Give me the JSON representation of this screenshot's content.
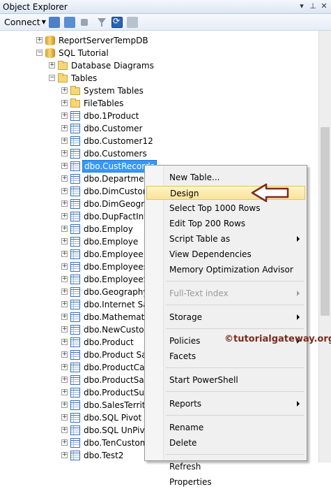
{
  "window": {
    "title": "Object Explorer",
    "pin_icon": "pin-icon",
    "close_icon": "close-icon"
  },
  "toolbar": {
    "connect_label": "Connect",
    "icons": [
      "connect-object-explorer-icon",
      "disconnect-icon",
      "stop-icon",
      "filter-icon",
      "refresh-icon",
      "activity-monitor-icon"
    ]
  },
  "tree": {
    "rows": [
      {
        "label": "ReportServerTempDB",
        "icon": "database-icon",
        "expander": "+"
      },
      {
        "label": "SQL Tutorial",
        "icon": "database-icon",
        "expander": "-"
      },
      {
        "label": "Database Diagrams",
        "icon": "folder-icon",
        "expander": "+"
      },
      {
        "label": "Tables",
        "icon": "folder-icon",
        "expander": "-"
      },
      {
        "label": "System Tables",
        "icon": "folder-icon",
        "expander": "+"
      },
      {
        "label": "FileTables",
        "icon": "folder-icon",
        "expander": "+"
      },
      {
        "label": "dbo.1Product",
        "icon": "table-icon",
        "expander": "+"
      },
      {
        "label": "dbo.Customer",
        "icon": "table-icon",
        "expander": "+"
      },
      {
        "label": "dbo.Customer12",
        "icon": "table-icon",
        "expander": "+"
      },
      {
        "label": "dbo.Customers",
        "icon": "table-icon",
        "expander": "+"
      },
      {
        "label": "dbo.CustRecords",
        "icon": "table-icon",
        "expander": "+",
        "selected": true
      },
      {
        "label": "dbo.Department",
        "icon": "table-icon",
        "expander": "+"
      },
      {
        "label": "dbo.DimCustom",
        "icon": "table-icon",
        "expander": "+"
      },
      {
        "label": "dbo.DimGeogra",
        "icon": "table-icon",
        "expander": "+"
      },
      {
        "label": "dbo.DupFactInte",
        "icon": "table-icon",
        "expander": "+"
      },
      {
        "label": "dbo.Employ",
        "icon": "table-icon",
        "expander": "+"
      },
      {
        "label": "dbo.Employe",
        "icon": "table-icon",
        "expander": "+"
      },
      {
        "label": "dbo.Employee",
        "icon": "table-icon",
        "expander": "+"
      },
      {
        "label": "dbo.Employees",
        "icon": "table-icon",
        "expander": "+"
      },
      {
        "label": "dbo.EmployeeSD",
        "icon": "table-icon",
        "expander": "+"
      },
      {
        "label": "dbo.Geography",
        "icon": "table-icon",
        "expander": "+"
      },
      {
        "label": "dbo.Internet Sal",
        "icon": "table-icon",
        "expander": "+"
      },
      {
        "label": "dbo.Mathematic",
        "icon": "table-icon",
        "expander": "+"
      },
      {
        "label": "dbo.NewCuston",
        "icon": "table-icon",
        "expander": "+"
      },
      {
        "label": "dbo.Product",
        "icon": "table-icon",
        "expander": "+"
      },
      {
        "label": "dbo.Product Sal",
        "icon": "table-icon",
        "expander": "+"
      },
      {
        "label": "dbo.ProductCat",
        "icon": "table-icon",
        "expander": "+"
      },
      {
        "label": "dbo.ProductSale",
        "icon": "table-icon",
        "expander": "+"
      },
      {
        "label": "dbo.ProductSub",
        "icon": "table-icon",
        "expander": "+"
      },
      {
        "label": "dbo.SalesTerrito",
        "icon": "table-icon",
        "expander": "+"
      },
      {
        "label": "dbo.SQL Pivot S",
        "icon": "table-icon",
        "expander": "+"
      },
      {
        "label": "dbo.SQL UnPivo",
        "icon": "table-icon",
        "expander": "+"
      },
      {
        "label": "dbo.TenCustom",
        "icon": "table-icon",
        "expander": "+"
      },
      {
        "label": "dbo.Test2",
        "icon": "table-icon",
        "expander": "+"
      }
    ]
  },
  "context_menu": {
    "items": [
      {
        "label": "New Table..."
      },
      {
        "label": "Design",
        "highlighted": true
      },
      {
        "label": "Select Top 1000 Rows"
      },
      {
        "label": "Edit Top 200 Rows"
      },
      {
        "label": "Script Table as",
        "submenu": true
      },
      {
        "label": "View Dependencies"
      },
      {
        "label": "Memory Optimization Advisor"
      },
      {
        "separator": true
      },
      {
        "label": "Full-Text index",
        "submenu": true,
        "disabled": true
      },
      {
        "separator": true
      },
      {
        "label": "Storage",
        "submenu": true
      },
      {
        "separator": true
      },
      {
        "label": "Policies",
        "submenu": true
      },
      {
        "label": "Facets"
      },
      {
        "separator": true
      },
      {
        "label": "Start PowerShell"
      },
      {
        "separator": true
      },
      {
        "label": "Reports",
        "submenu": true
      },
      {
        "separator": true
      },
      {
        "label": "Rename"
      },
      {
        "label": "Delete"
      },
      {
        "separator": true
      },
      {
        "label": "Refresh"
      },
      {
        "label": "Properties"
      }
    ]
  },
  "watermark": "©tutorialgateway.org",
  "colors": {
    "selection": "#3399ff",
    "menu_highlight": "#fbe49a",
    "pointer_arrow": "#7a2b1c"
  }
}
